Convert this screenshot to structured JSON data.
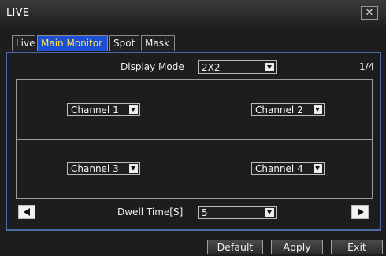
{
  "window": {
    "title": "LIVE",
    "close_symbol": "✕"
  },
  "tabs": [
    {
      "label": "Live",
      "active": false
    },
    {
      "label": "Main Monitor",
      "active": true
    },
    {
      "label": "Spot",
      "active": false
    },
    {
      "label": "Mask",
      "active": false
    }
  ],
  "display_mode": {
    "label": "Display Mode",
    "value": "2X2",
    "page": "1/4"
  },
  "channels": [
    "Channel 1",
    "Channel 2",
    "Channel 3",
    "Channel 4"
  ],
  "dwell": {
    "label": "Dwell Time[S]",
    "value": "5"
  },
  "buttons": {
    "default": "Default",
    "apply": "Apply",
    "exit": "Exit"
  },
  "colors": {
    "active_tab_bg": "#1a4fd6",
    "active_tab_text": "#ffe84a",
    "panel_border": "#4a6aa8"
  }
}
